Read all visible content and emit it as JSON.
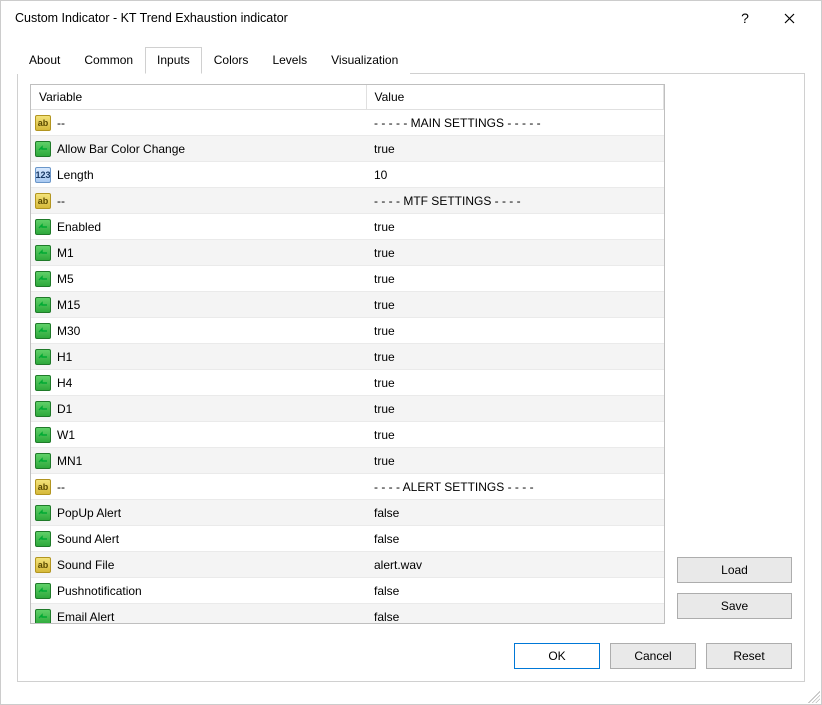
{
  "window": {
    "title": "Custom Indicator - KT Trend Exhaustion indicator"
  },
  "tabs": {
    "about": "About",
    "common": "Common",
    "inputs": "Inputs",
    "colors": "Colors",
    "levels": "Levels",
    "visualization": "Visualization",
    "active": "inputs"
  },
  "table": {
    "header_variable": "Variable",
    "header_value": "Value",
    "rows": [
      {
        "icon": "ab",
        "variable": "--",
        "value": "- - - - - MAIN SETTINGS - - - - -"
      },
      {
        "icon": "bool",
        "variable": "Allow Bar Color Change",
        "value": "true"
      },
      {
        "icon": "num",
        "variable": "Length",
        "value": "10"
      },
      {
        "icon": "ab",
        "variable": "--",
        "value": "- - - - MTF SETTINGS - - - -"
      },
      {
        "icon": "bool",
        "variable": "Enabled",
        "value": "true"
      },
      {
        "icon": "bool",
        "variable": "M1",
        "value": "true"
      },
      {
        "icon": "bool",
        "variable": "M5",
        "value": "true"
      },
      {
        "icon": "bool",
        "variable": "M15",
        "value": "true"
      },
      {
        "icon": "bool",
        "variable": "M30",
        "value": "true"
      },
      {
        "icon": "bool",
        "variable": "H1",
        "value": "true"
      },
      {
        "icon": "bool",
        "variable": "H4",
        "value": "true"
      },
      {
        "icon": "bool",
        "variable": "D1",
        "value": "true"
      },
      {
        "icon": "bool",
        "variable": "W1",
        "value": "true"
      },
      {
        "icon": "bool",
        "variable": "MN1",
        "value": "true"
      },
      {
        "icon": "ab",
        "variable": "--",
        "value": "- - - - ALERT SETTINGS - - - -"
      },
      {
        "icon": "bool",
        "variable": "PopUp Alert",
        "value": "false"
      },
      {
        "icon": "bool",
        "variable": "Sound Alert",
        "value": "false"
      },
      {
        "icon": "ab",
        "variable": "Sound File",
        "value": "alert.wav"
      },
      {
        "icon": "bool",
        "variable": "Pushnotification",
        "value": "false"
      },
      {
        "icon": "bool",
        "variable": "Email Alert",
        "value": "false"
      }
    ]
  },
  "buttons": {
    "load": "Load",
    "save": "Save",
    "ok": "OK",
    "cancel": "Cancel",
    "reset": "Reset"
  },
  "icon_text": {
    "ab": "ab",
    "num": "123",
    "bool": ""
  }
}
